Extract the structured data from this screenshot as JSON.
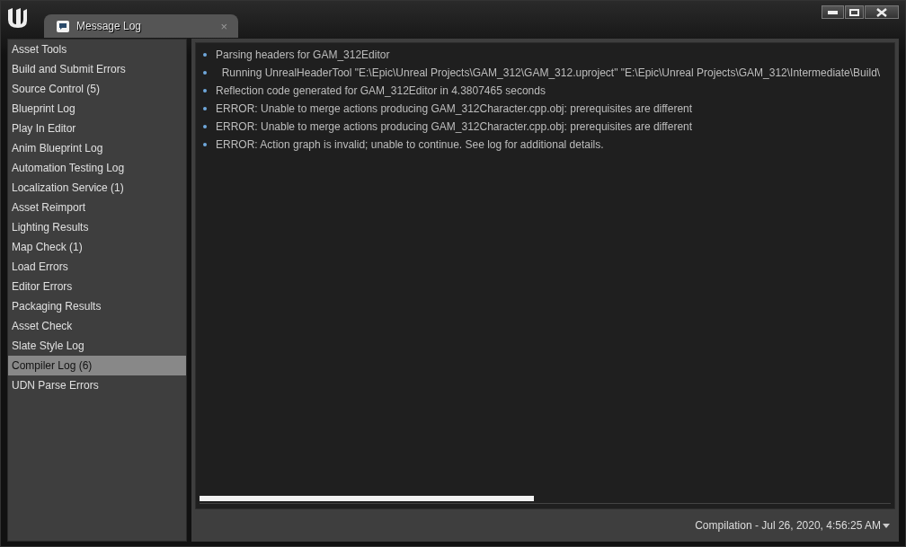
{
  "window": {
    "tab": {
      "title": "Message Log",
      "close": "×"
    }
  },
  "sidebar": {
    "items": [
      {
        "label": "Asset Tools",
        "selected": false
      },
      {
        "label": "Build and Submit Errors",
        "selected": false
      },
      {
        "label": "Source Control (5)",
        "selected": false
      },
      {
        "label": "Blueprint Log",
        "selected": false
      },
      {
        "label": "Play In Editor",
        "selected": false
      },
      {
        "label": "Anim Blueprint Log",
        "selected": false
      },
      {
        "label": "Automation Testing Log",
        "selected": false
      },
      {
        "label": "Localization Service (1)",
        "selected": false
      },
      {
        "label": "Asset Reimport",
        "selected": false
      },
      {
        "label": "Lighting Results",
        "selected": false
      },
      {
        "label": "Map Check (1)",
        "selected": false
      },
      {
        "label": "Load Errors",
        "selected": false
      },
      {
        "label": "Editor Errors",
        "selected": false
      },
      {
        "label": "Packaging Results",
        "selected": false
      },
      {
        "label": "Asset Check",
        "selected": false
      },
      {
        "label": "Slate Style Log",
        "selected": false
      },
      {
        "label": "Compiler Log (6)",
        "selected": true
      },
      {
        "label": "UDN Parse Errors",
        "selected": false
      }
    ]
  },
  "log": {
    "messages": [
      "Parsing headers for GAM_312Editor",
      "  Running UnrealHeaderTool \"E:\\Epic\\Unreal Projects\\GAM_312\\GAM_312.uproject\" \"E:\\Epic\\Unreal Projects\\GAM_312\\Intermediate\\Build\\",
      "Reflection code generated for GAM_312Editor in 4.3807465 seconds",
      "ERROR: Unable to merge actions producing GAM_312Character.cpp.obj: prerequisites are different",
      "ERROR: Unable to merge actions producing GAM_312Character.cpp.obj: prerequisites are different",
      "ERROR: Action graph is invalid; unable to continue. See log for additional details."
    ]
  },
  "footer": {
    "page_selector": "Compilation - Jul 26, 2020, 4:56:25 AM"
  }
}
